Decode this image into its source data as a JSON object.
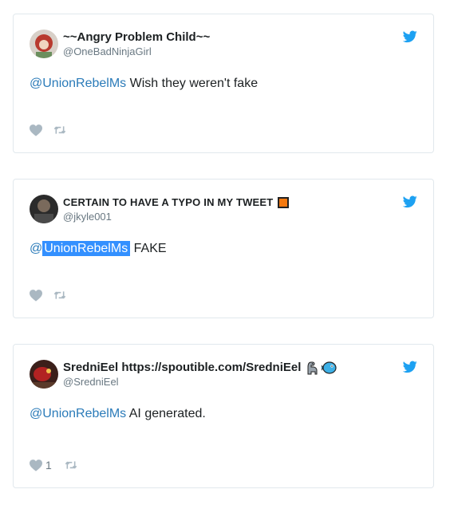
{
  "tweets": [
    {
      "display_name": "~~Angry Problem Child~~",
      "handle": "@OneBadNinjaGirl",
      "mention": "@UnionRebelMs",
      "text": " Wish they weren't fake",
      "like_count": "",
      "avatar_color": "#c0392b"
    },
    {
      "display_name": "CERTAIN TO HAVE A TYPO IN MY TWEET",
      "handle": "@jkyle001",
      "mention": "@UnionRebelMs",
      "text": " FAKE",
      "like_count": "",
      "avatar_color": "#3a3a3a"
    },
    {
      "display_name": "SredniEel https://spoutible.com/SredniEel",
      "handle": "@SredniEel",
      "mention": "@UnionRebelMs",
      "text": " AI generated.",
      "like_count": "1",
      "avatar_color": "#b22222"
    }
  ],
  "colors": {
    "twitter_blue": "#1da1f2",
    "mention": "#2b7bb9",
    "muted": "#697882",
    "icon_grey": "#aab8c2",
    "border": "#e1e8ed"
  },
  "icons": [
    "twitter-bird-icon",
    "heart-icon",
    "retweet-icon",
    "orange-square-icon",
    "dinosaur-icon",
    "blue-fish-icon"
  ]
}
